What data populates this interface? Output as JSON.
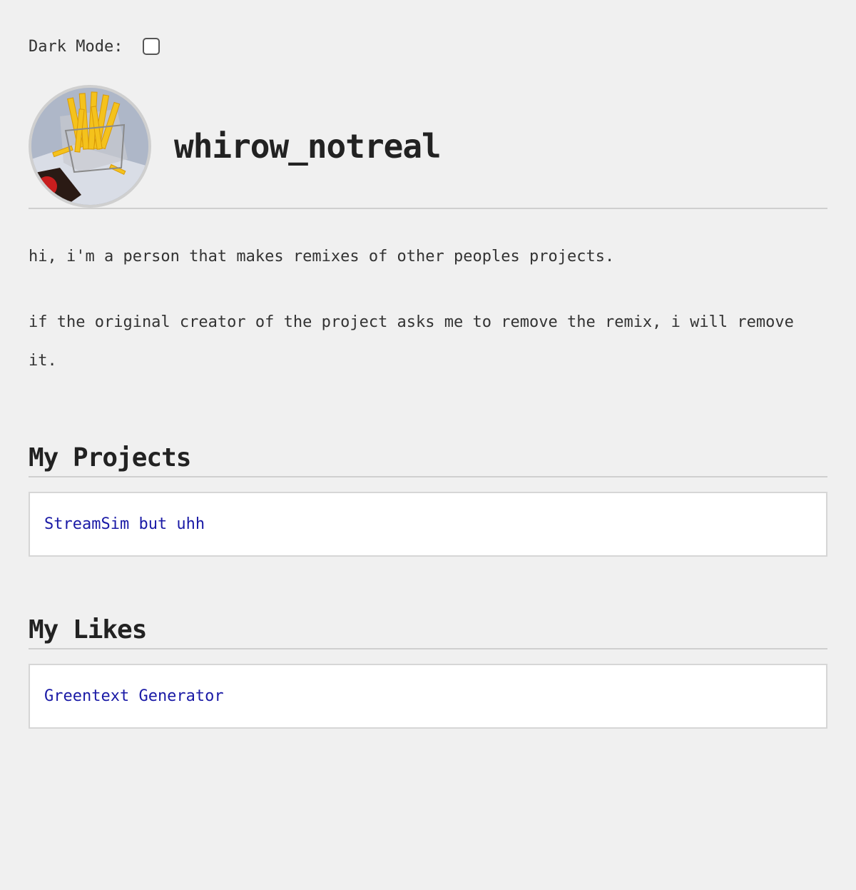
{
  "settings": {
    "dark_mode_label": "Dark Mode:",
    "dark_mode_checked": false
  },
  "profile": {
    "username": "whirow_notreal",
    "avatar_icon": "french-fries-photo"
  },
  "bio": {
    "line1": "hi, i'm a person that makes remixes of other peoples projects.",
    "line2": "if the original creator of the project asks me to remove the remix, i will remove it."
  },
  "projects": {
    "title": "My Projects",
    "items": [
      {
        "label": "StreamSim but uhh"
      }
    ]
  },
  "likes": {
    "title": "My Likes",
    "items": [
      {
        "label": "Greentext Generator"
      }
    ]
  },
  "colors": {
    "background": "#f0f0f0",
    "link": "#1a1aa6",
    "rule": "#cfcfcf"
  }
}
